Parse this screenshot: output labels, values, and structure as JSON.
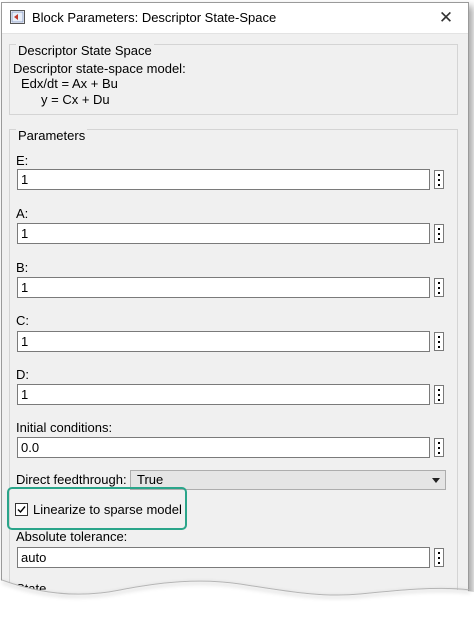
{
  "window": {
    "title": "Block Parameters: Descriptor State-Space",
    "close_glyph": "✕"
  },
  "description": {
    "legend": "Descriptor State Space",
    "line1": "Descriptor state-space model:",
    "line2": "Edx/dt = Ax + Bu",
    "line3": "y = Cx + Du"
  },
  "parameters": {
    "legend": "Parameters",
    "fields": [
      {
        "label": "E:",
        "value": "1"
      },
      {
        "label": "A:",
        "value": "1"
      },
      {
        "label": "B:",
        "value": "1"
      },
      {
        "label": "C:",
        "value": "1"
      },
      {
        "label": "D:",
        "value": "1"
      },
      {
        "label": "Initial conditions:",
        "value": "0.0"
      }
    ],
    "direct_feedthrough": {
      "label": "Direct feedthrough:",
      "selected": "True"
    },
    "linearize": {
      "label": "Linearize to sparse model",
      "checked": true
    },
    "absolute_tolerance": {
      "label": "Absolute tolerance:",
      "value": "auto"
    },
    "cut_off_label": "State"
  },
  "colors": {
    "highlight": "#2aa58a",
    "window_bg": "#f0f0f0"
  }
}
